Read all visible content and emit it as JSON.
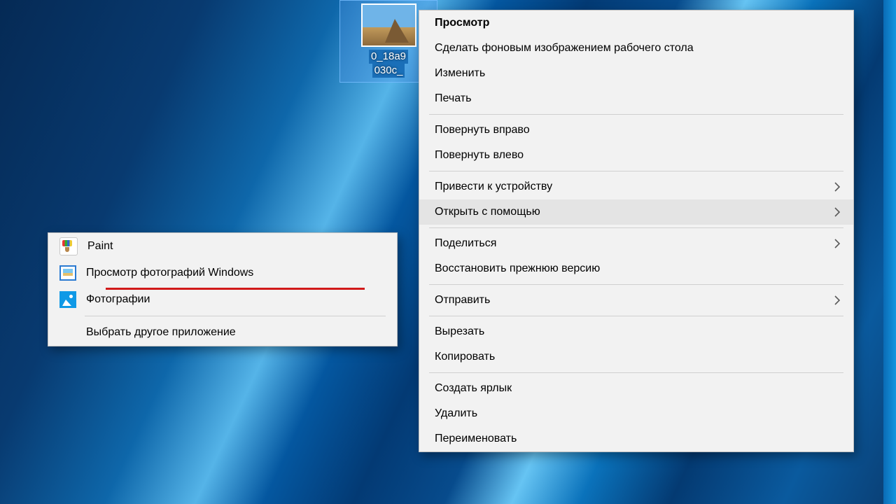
{
  "desktop_icon": {
    "filename_line1": "0_18a9",
    "filename_line2": "030c_"
  },
  "context_menu": {
    "preview": "Просмотр",
    "set_wallpaper": "Сделать фоновым изображением рабочего стола",
    "edit": "Изменить",
    "print": "Печать",
    "rotate_right": "Повернуть вправо",
    "rotate_left": "Повернуть влево",
    "cast_to_device": "Привести к устройству",
    "open_with": "Открыть с помощью",
    "share": "Поделиться",
    "restore_prev": "Восстановить прежнюю версию",
    "send_to": "Отправить",
    "cut": "Вырезать",
    "copy": "Копировать",
    "create_shortcut": "Создать ярлык",
    "delete": "Удалить",
    "rename": "Переименовать"
  },
  "open_with_menu": {
    "paint": "Paint",
    "photo_viewer": "Просмотр фотографий Windows",
    "photos": "Фотографии",
    "choose_other": "Выбрать другое приложение"
  },
  "colors": {
    "highlight_underline": "#d11a1a"
  }
}
